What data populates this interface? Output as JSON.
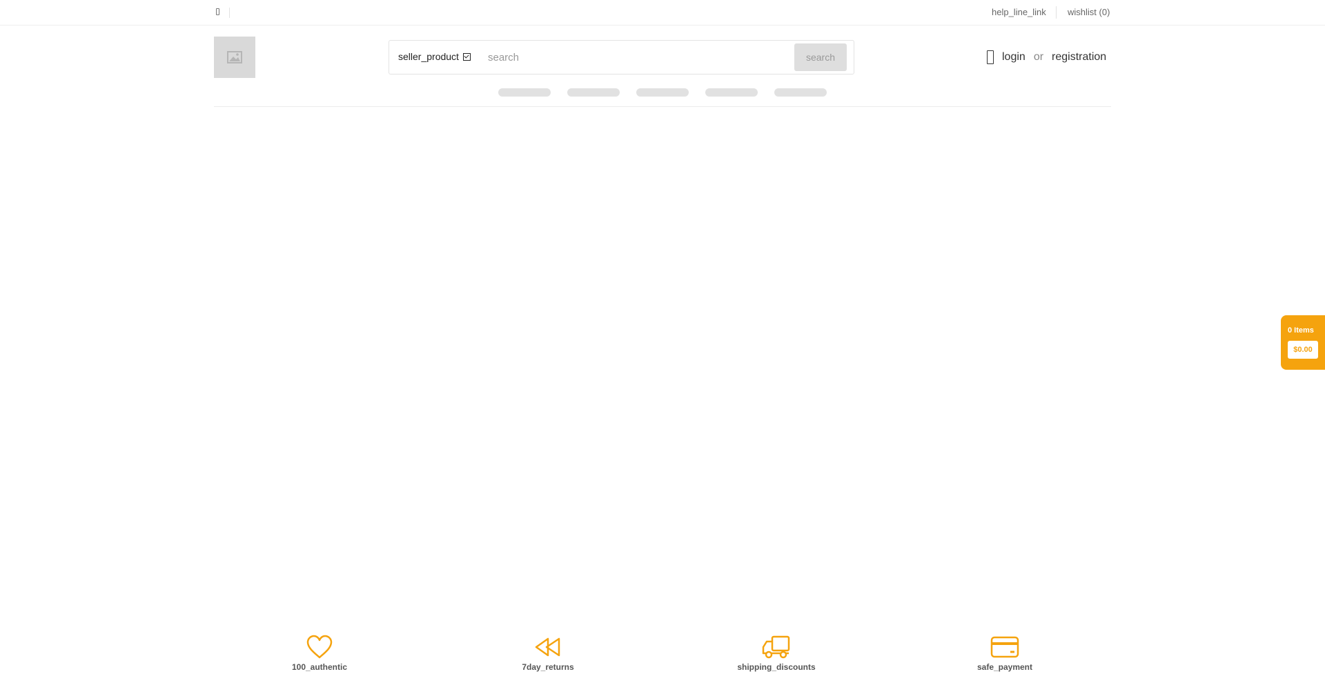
{
  "topbar": {
    "language_icon": "language-icon",
    "help_link": "help_line_link",
    "wishlist": "wishlist (0)"
  },
  "header": {
    "logo_icon": "image-placeholder-icon",
    "search": {
      "scope_label": "seller_product",
      "placeholder": "search",
      "button_label": "search"
    },
    "account": {
      "user_icon": "user-icon",
      "login": "login",
      "or": "or",
      "registration": "registration"
    }
  },
  "cart": {
    "items": "0 Items",
    "total": "$0.00"
  },
  "features": [
    {
      "label": "100_authentic",
      "icon": "heart-icon"
    },
    {
      "label": "7day_returns",
      "icon": "rewind-icon"
    },
    {
      "label": "shipping_discounts",
      "icon": "truck-icon"
    },
    {
      "label": "safe_payment",
      "icon": "credit-card-icon"
    }
  ],
  "colors": {
    "accent": "#f5a30e",
    "skeleton": "#e1e1e1",
    "logo_placeholder": "#d9d9d9"
  }
}
